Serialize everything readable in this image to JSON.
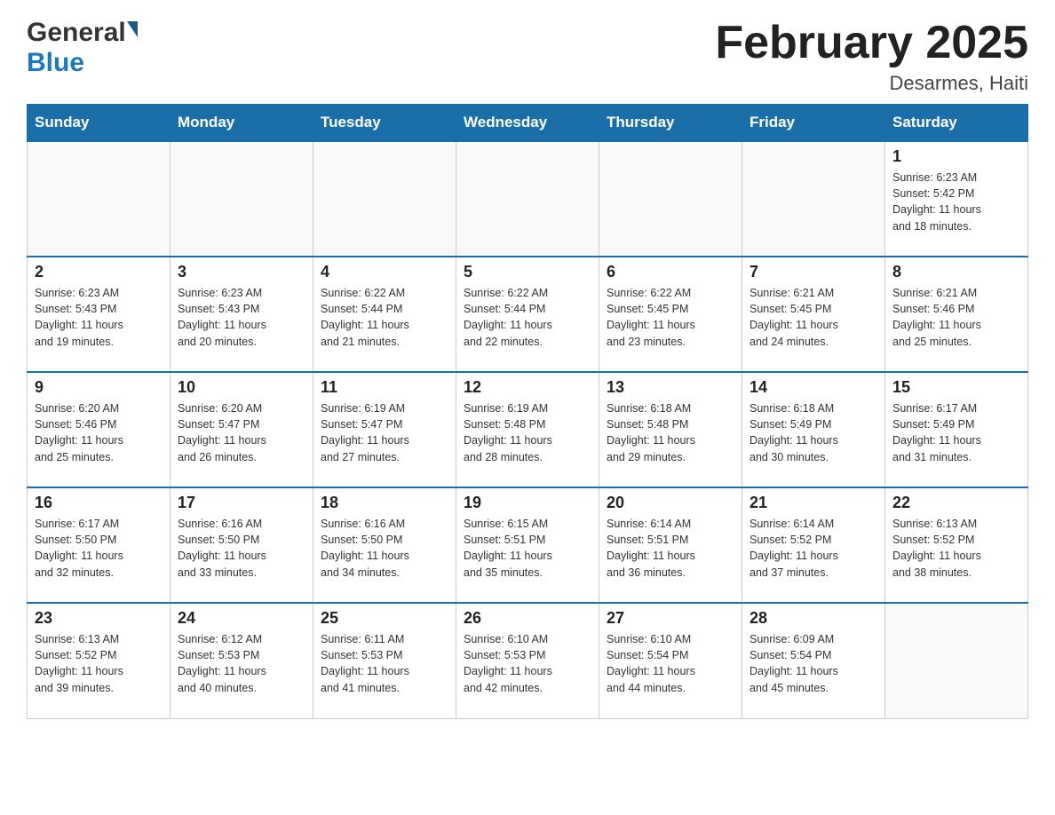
{
  "header": {
    "logo_general": "General",
    "logo_blue": "Blue",
    "month_title": "February 2025",
    "location": "Desarmes, Haiti"
  },
  "weekdays": [
    "Sunday",
    "Monday",
    "Tuesday",
    "Wednesday",
    "Thursday",
    "Friday",
    "Saturday"
  ],
  "weeks": [
    [
      {
        "day": "",
        "info": ""
      },
      {
        "day": "",
        "info": ""
      },
      {
        "day": "",
        "info": ""
      },
      {
        "day": "",
        "info": ""
      },
      {
        "day": "",
        "info": ""
      },
      {
        "day": "",
        "info": ""
      },
      {
        "day": "1",
        "info": "Sunrise: 6:23 AM\nSunset: 5:42 PM\nDaylight: 11 hours\nand 18 minutes."
      }
    ],
    [
      {
        "day": "2",
        "info": "Sunrise: 6:23 AM\nSunset: 5:43 PM\nDaylight: 11 hours\nand 19 minutes."
      },
      {
        "day": "3",
        "info": "Sunrise: 6:23 AM\nSunset: 5:43 PM\nDaylight: 11 hours\nand 20 minutes."
      },
      {
        "day": "4",
        "info": "Sunrise: 6:22 AM\nSunset: 5:44 PM\nDaylight: 11 hours\nand 21 minutes."
      },
      {
        "day": "5",
        "info": "Sunrise: 6:22 AM\nSunset: 5:44 PM\nDaylight: 11 hours\nand 22 minutes."
      },
      {
        "day": "6",
        "info": "Sunrise: 6:22 AM\nSunset: 5:45 PM\nDaylight: 11 hours\nand 23 minutes."
      },
      {
        "day": "7",
        "info": "Sunrise: 6:21 AM\nSunset: 5:45 PM\nDaylight: 11 hours\nand 24 minutes."
      },
      {
        "day": "8",
        "info": "Sunrise: 6:21 AM\nSunset: 5:46 PM\nDaylight: 11 hours\nand 25 minutes."
      }
    ],
    [
      {
        "day": "9",
        "info": "Sunrise: 6:20 AM\nSunset: 5:46 PM\nDaylight: 11 hours\nand 25 minutes."
      },
      {
        "day": "10",
        "info": "Sunrise: 6:20 AM\nSunset: 5:47 PM\nDaylight: 11 hours\nand 26 minutes."
      },
      {
        "day": "11",
        "info": "Sunrise: 6:19 AM\nSunset: 5:47 PM\nDaylight: 11 hours\nand 27 minutes."
      },
      {
        "day": "12",
        "info": "Sunrise: 6:19 AM\nSunset: 5:48 PM\nDaylight: 11 hours\nand 28 minutes."
      },
      {
        "day": "13",
        "info": "Sunrise: 6:18 AM\nSunset: 5:48 PM\nDaylight: 11 hours\nand 29 minutes."
      },
      {
        "day": "14",
        "info": "Sunrise: 6:18 AM\nSunset: 5:49 PM\nDaylight: 11 hours\nand 30 minutes."
      },
      {
        "day": "15",
        "info": "Sunrise: 6:17 AM\nSunset: 5:49 PM\nDaylight: 11 hours\nand 31 minutes."
      }
    ],
    [
      {
        "day": "16",
        "info": "Sunrise: 6:17 AM\nSunset: 5:50 PM\nDaylight: 11 hours\nand 32 minutes."
      },
      {
        "day": "17",
        "info": "Sunrise: 6:16 AM\nSunset: 5:50 PM\nDaylight: 11 hours\nand 33 minutes."
      },
      {
        "day": "18",
        "info": "Sunrise: 6:16 AM\nSunset: 5:50 PM\nDaylight: 11 hours\nand 34 minutes."
      },
      {
        "day": "19",
        "info": "Sunrise: 6:15 AM\nSunset: 5:51 PM\nDaylight: 11 hours\nand 35 minutes."
      },
      {
        "day": "20",
        "info": "Sunrise: 6:14 AM\nSunset: 5:51 PM\nDaylight: 11 hours\nand 36 minutes."
      },
      {
        "day": "21",
        "info": "Sunrise: 6:14 AM\nSunset: 5:52 PM\nDaylight: 11 hours\nand 37 minutes."
      },
      {
        "day": "22",
        "info": "Sunrise: 6:13 AM\nSunset: 5:52 PM\nDaylight: 11 hours\nand 38 minutes."
      }
    ],
    [
      {
        "day": "23",
        "info": "Sunrise: 6:13 AM\nSunset: 5:52 PM\nDaylight: 11 hours\nand 39 minutes."
      },
      {
        "day": "24",
        "info": "Sunrise: 6:12 AM\nSunset: 5:53 PM\nDaylight: 11 hours\nand 40 minutes."
      },
      {
        "day": "25",
        "info": "Sunrise: 6:11 AM\nSunset: 5:53 PM\nDaylight: 11 hours\nand 41 minutes."
      },
      {
        "day": "26",
        "info": "Sunrise: 6:10 AM\nSunset: 5:53 PM\nDaylight: 11 hours\nand 42 minutes."
      },
      {
        "day": "27",
        "info": "Sunrise: 6:10 AM\nSunset: 5:54 PM\nDaylight: 11 hours\nand 44 minutes."
      },
      {
        "day": "28",
        "info": "Sunrise: 6:09 AM\nSunset: 5:54 PM\nDaylight: 11 hours\nand 45 minutes."
      },
      {
        "day": "",
        "info": ""
      }
    ]
  ]
}
